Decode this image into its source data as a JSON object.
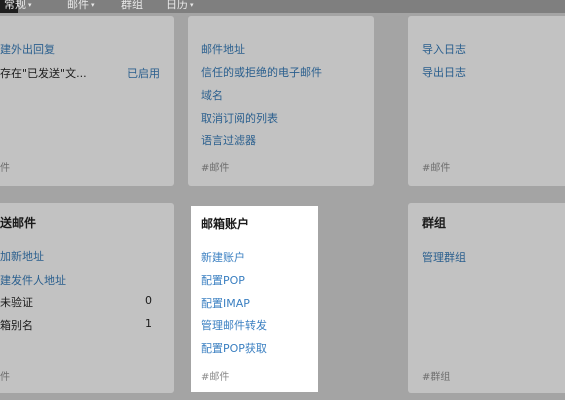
{
  "nav": {
    "item1": "常规",
    "item2": "邮件",
    "item3": "群组",
    "item4": "日历",
    "caret": "▾"
  },
  "cards": {
    "c1": {
      "links": [
        "建外出回复"
      ],
      "row_label": "存在\"已发送\"文...",
      "row_status": "已启用",
      "tag": "件"
    },
    "c2": {
      "links": [
        "邮件地址",
        "信任的或拒绝的电子邮件",
        "域名",
        "取消订阅的列表",
        "语言过滤器"
      ],
      "tag": "#邮件"
    },
    "c3": {
      "links": [
        "导入日志",
        "导出日志"
      ],
      "tag": "#邮件"
    },
    "c4": {
      "title": "送邮件",
      "links": [
        "加新地址",
        "建发件人地址"
      ],
      "rows": [
        {
          "label": "未验证",
          "value": "0"
        },
        {
          "label": "箱别名",
          "value": "1"
        }
      ],
      "tag": "件"
    },
    "c5": {
      "title": "邮箱账户",
      "links": [
        "新建账户",
        "配置POP",
        "配置IMAP",
        "管理邮件转发",
        "配置POP获取"
      ],
      "tag": "#邮件"
    },
    "c6": {
      "title": "群组",
      "links": [
        "管理群组"
      ],
      "tag": "#群组"
    }
  }
}
